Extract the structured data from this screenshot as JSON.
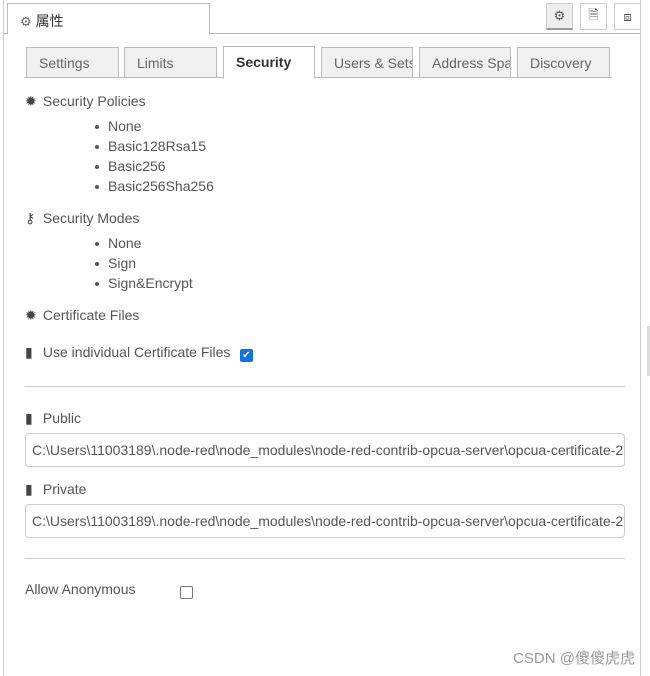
{
  "header": {
    "title": "属性",
    "title_icon": "gear-icon",
    "buttons": [
      {
        "icon": "gear-icon"
      },
      {
        "icon": "document-icon"
      },
      {
        "icon": "frame-icon"
      }
    ]
  },
  "tabs": [
    {
      "label": "Settings"
    },
    {
      "label": "Limits"
    },
    {
      "label": "Security",
      "active": true
    },
    {
      "label": "Users & Sets"
    },
    {
      "label": "Address Space"
    },
    {
      "label": "Discovery"
    }
  ],
  "security_policies": {
    "label": "Security Policies",
    "items": [
      "None",
      "Basic128Rsa15",
      "Basic256",
      "Basic256Sha256"
    ]
  },
  "security_modes": {
    "label": "Security Modes",
    "items": [
      "None",
      "Sign",
      "Sign&Encrypt"
    ]
  },
  "certificate_files": {
    "label": "Certificate Files"
  },
  "use_individual": {
    "label": "Use individual Certificate Files",
    "checked": true
  },
  "public": {
    "label": "Public",
    "value": "C:\\Users\\11003189\\.node-red\\node_modules\\node-red-contrib-opcua-server\\opcua-certificate-2"
  },
  "private": {
    "label": "Private",
    "value": "C:\\Users\\11003189\\.node-red\\node_modules\\node-red-contrib-opcua-server\\opcua-certificate-2"
  },
  "allow_anonymous": {
    "label": "Allow Anonymous",
    "checked": false
  },
  "watermark": "CSDN @傻傻虎虎",
  "colors": {
    "accent": "#0b74e5"
  }
}
